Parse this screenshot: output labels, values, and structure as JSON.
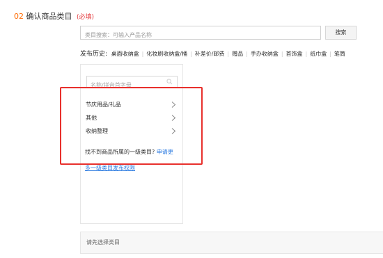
{
  "section": {
    "number": "02",
    "title": "确认商品类目",
    "required": "(必填)"
  },
  "search": {
    "placeholder": "类目搜索：可输入产品名称",
    "button": "搜索"
  },
  "history": {
    "label": "发布历史:",
    "items": [
      "桌面收纳盒",
      "化妆刷收纳盒/桶",
      "补差价/邮费",
      "赠品",
      "手办收纳盒",
      "首饰盒",
      "纸巾盒",
      "笔筒"
    ]
  },
  "panel": {
    "search_placeholder": "名称/拼音首字母",
    "search_icon": "search-icon",
    "categories": [
      {
        "label": "节庆用品/礼品",
        "icon": "chevron-right-icon"
      },
      {
        "label": "其他",
        "icon": "chevron-right-icon"
      },
      {
        "label": "收纳整理",
        "icon": "chevron-right-icon"
      }
    ],
    "help_text": "找不到商品所属的一级类目?",
    "help_link": "申请更",
    "help_link2": "多一级类目发布权限"
  },
  "status": {
    "text": "请先选择类目"
  },
  "colors": {
    "accent": "#ff6a00",
    "required": "#e4393c",
    "link": "#2f7de1",
    "highlight": "#e8302c"
  }
}
